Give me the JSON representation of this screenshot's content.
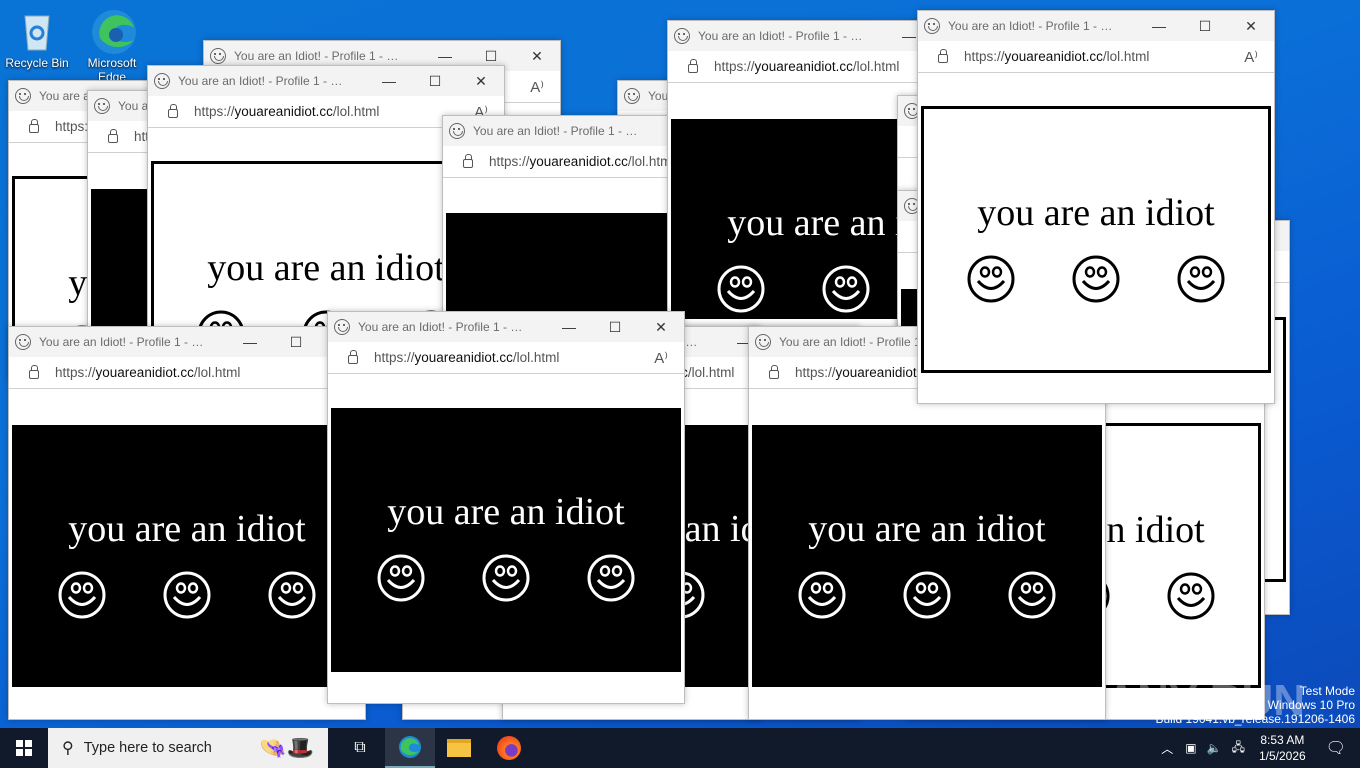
{
  "desktop": {
    "icons": [
      {
        "label": "Recycle Bin"
      },
      {
        "label": "Microsoft Edge"
      }
    ]
  },
  "browser": {
    "title": "You are an Idiot! - Profile 1 - Micro...",
    "url_scheme": "https://",
    "url_host": "youareanidiot.cc",
    "url_path": "/lol.html",
    "minimize": "—",
    "maximize": "☐",
    "close": "✕",
    "read_aloud": "A⁾",
    "message": "you are an idiot"
  },
  "watermark": {
    "brand": "ANY RUN",
    "line1": "Test Mode",
    "line2": "Windows 10 Pro",
    "line3": "Build 19041.vb_release.191206-1406"
  },
  "taskbar": {
    "search_placeholder": "Type here to search",
    "time": "8:53 AM",
    "date": "1/5/2026"
  }
}
